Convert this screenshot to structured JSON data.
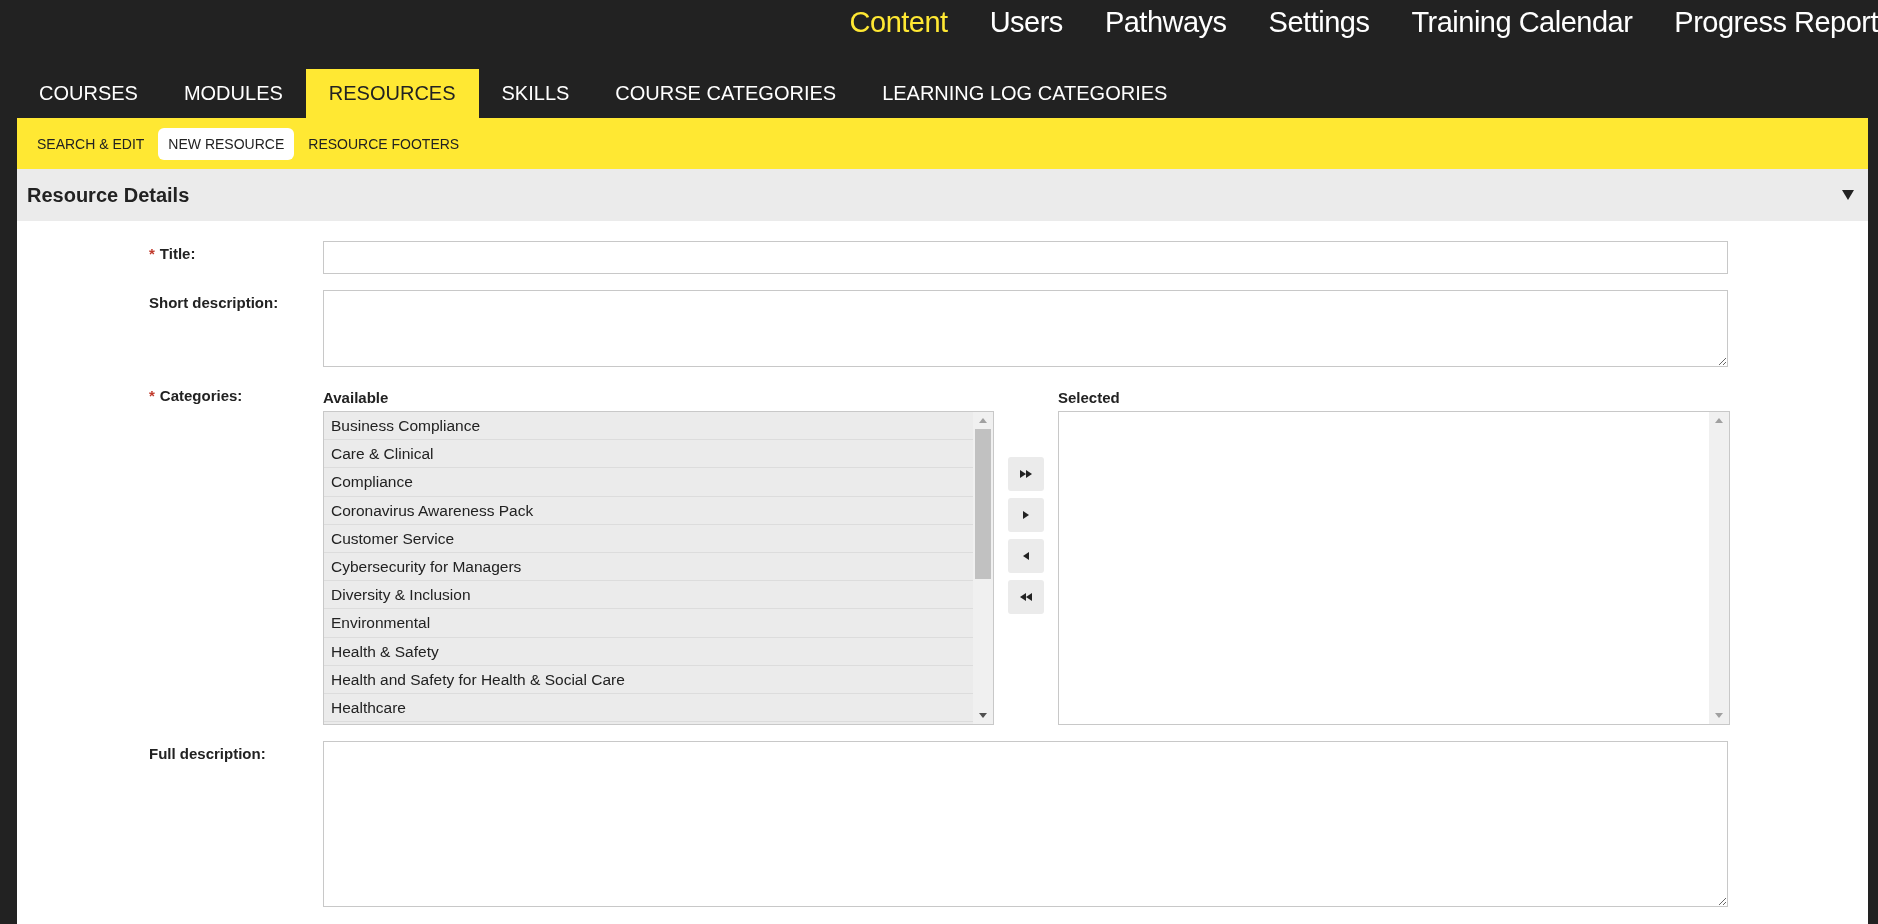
{
  "top_nav": [
    {
      "label": "Content",
      "selected": true
    },
    {
      "label": "Users",
      "selected": false
    },
    {
      "label": "Pathways",
      "selected": false
    },
    {
      "label": "Settings",
      "selected": false
    },
    {
      "label": "Training Calendar",
      "selected": false
    },
    {
      "label": "Progress Report",
      "selected": false
    }
  ],
  "tabs": [
    {
      "label": "COURSES",
      "selected": false
    },
    {
      "label": "MODULES",
      "selected": false
    },
    {
      "label": "RESOURCES",
      "selected": true
    },
    {
      "label": "SKILLS",
      "selected": false
    },
    {
      "label": "COURSE CATEGORIES",
      "selected": false
    },
    {
      "label": "LEARNING LOG CATEGORIES",
      "selected": false
    }
  ],
  "sub_tabs": [
    {
      "label": "SEARCH & EDIT",
      "selected": false
    },
    {
      "label": "NEW RESOURCE",
      "selected": true
    },
    {
      "label": "RESOURCE FOOTERS",
      "selected": false
    }
  ],
  "section": {
    "title": "Resource Details",
    "expanded": true
  },
  "form": {
    "title": {
      "label": "Title:",
      "required_mark": "*"
    },
    "short_description": {
      "label": "Short description:"
    },
    "categories": {
      "label": "Categories:",
      "required_mark": "*",
      "available_label": "Available",
      "selected_label": "Selected",
      "available": [
        "Business Compliance",
        "Care & Clinical",
        "Compliance",
        "Coronavirus Awareness Pack",
        "Customer Service",
        "Cybersecurity for Managers",
        "Diversity & Inclusion",
        "Environmental",
        "Health & Safety",
        "Health and Safety for Health & Social Care",
        "Healthcare"
      ]
    },
    "full_description": {
      "label": "Full description:"
    }
  }
}
